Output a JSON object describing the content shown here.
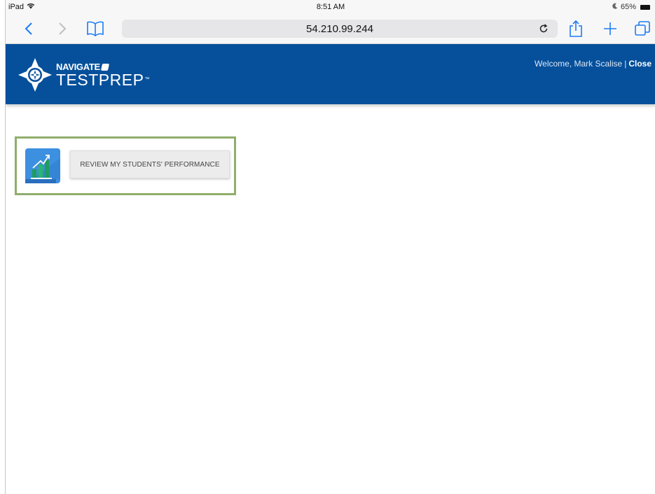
{
  "status_bar": {
    "device": "iPad",
    "time": "8:51 AM",
    "battery": "65%"
  },
  "browser": {
    "url": "54.210.99.244",
    "icons": [
      "back-chevron-icon",
      "forward-chevron-icon",
      "bookmarks-book-icon",
      "reload-icon",
      "share-icon",
      "plus-icon",
      "tabs-icon"
    ]
  },
  "header": {
    "logo_line1": "NAVIGATE",
    "logo_line2": "TESTPREP",
    "logo_tm": "™",
    "welcome": "Welcome, Mark Scalise",
    "separator": "|",
    "close_label": "Close",
    "background_color": "#06509b"
  },
  "main": {
    "review_button_label": "REVIEW MY STUDENTS' PERFORMANCE",
    "highlight_color": "#8fae6c"
  }
}
